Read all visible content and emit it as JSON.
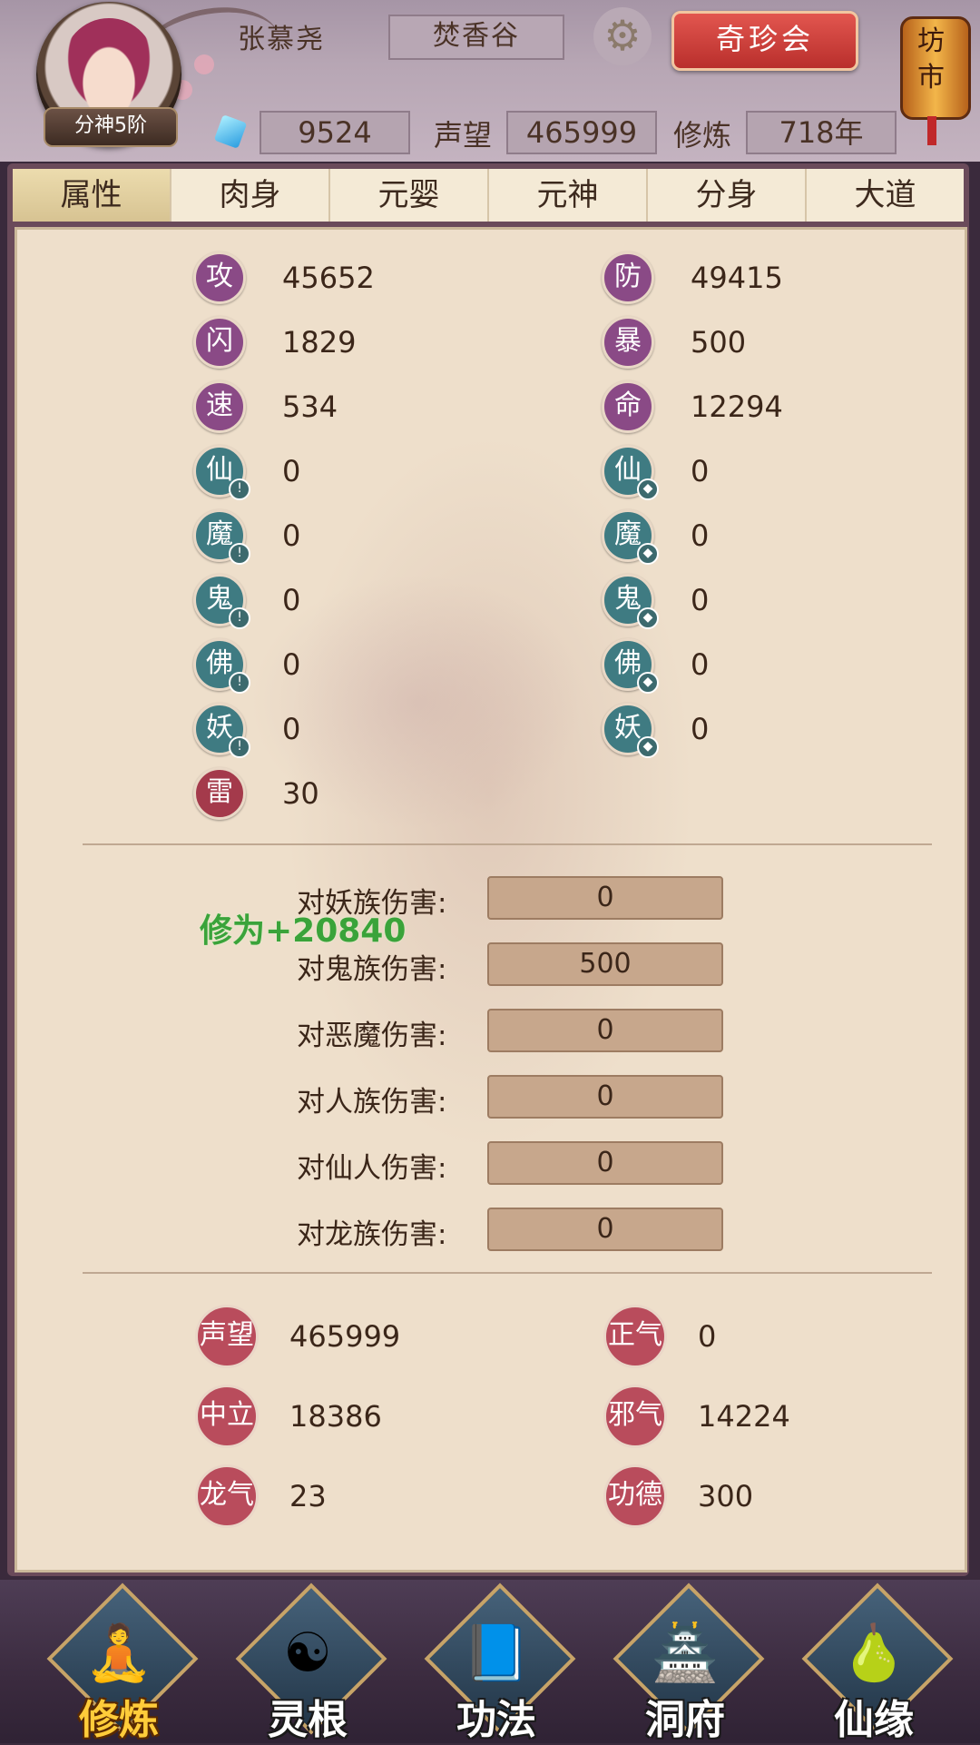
{
  "header": {
    "avatar_badge": "分神5阶",
    "name": "张慕尧",
    "sect": "焚香谷",
    "market_button": "奇珍会",
    "lantern_text": "坊市",
    "currency": "9524",
    "reputation_label": "声望",
    "reputation": "465999",
    "cultivation_label": "修炼",
    "cultivation": "718年"
  },
  "tabs": [
    "属性",
    "肉身",
    "元婴",
    "元神",
    "分身",
    "大道"
  ],
  "attributes": [
    {
      "icon": "攻",
      "value": "45652"
    },
    {
      "icon": "防",
      "value": "49415"
    },
    {
      "icon": "闪",
      "value": "1829"
    },
    {
      "icon": "暴",
      "value": "500"
    },
    {
      "icon": "速",
      "value": "534"
    },
    {
      "icon": "命",
      "value": "12294"
    },
    {
      "icon": "仙",
      "value": "0"
    },
    {
      "icon": "仙",
      "value": "0"
    },
    {
      "icon": "魔",
      "value": "0"
    },
    {
      "icon": "魔",
      "value": "0"
    },
    {
      "icon": "鬼",
      "value": "0"
    },
    {
      "icon": "鬼",
      "value": "0"
    },
    {
      "icon": "佛",
      "value": "0"
    },
    {
      "icon": "佛",
      "value": "0"
    },
    {
      "icon": "妖",
      "value": "0"
    },
    {
      "icon": "妖",
      "value": "0"
    },
    {
      "icon": "雷",
      "value": "30"
    }
  ],
  "damage": [
    {
      "label": "对妖族伤害:",
      "value": "0"
    },
    {
      "label": "对鬼族伤害:",
      "value": "500"
    },
    {
      "label": "对恶魔伤害:",
      "value": "0"
    },
    {
      "label": "对人族伤害:",
      "value": "0"
    },
    {
      "label": "对仙人伤害:",
      "value": "0"
    },
    {
      "label": "对龙族伤害:",
      "value": "0"
    }
  ],
  "floating_text": "修为+20840",
  "reputation_stats": [
    {
      "label": "声望",
      "value": "465999"
    },
    {
      "label": "正气",
      "value": "0"
    },
    {
      "label": "中立",
      "value": "18386"
    },
    {
      "label": "邪气",
      "value": "14224"
    },
    {
      "label": "龙气",
      "value": "23"
    },
    {
      "label": "功德",
      "value": "300"
    }
  ],
  "nav": [
    "修炼",
    "灵根",
    "功法",
    "洞府",
    "仙缘"
  ],
  "colors": {
    "accent": "#b92f2c",
    "panel": "#eedfcb",
    "float_text": "#3aa33a"
  }
}
